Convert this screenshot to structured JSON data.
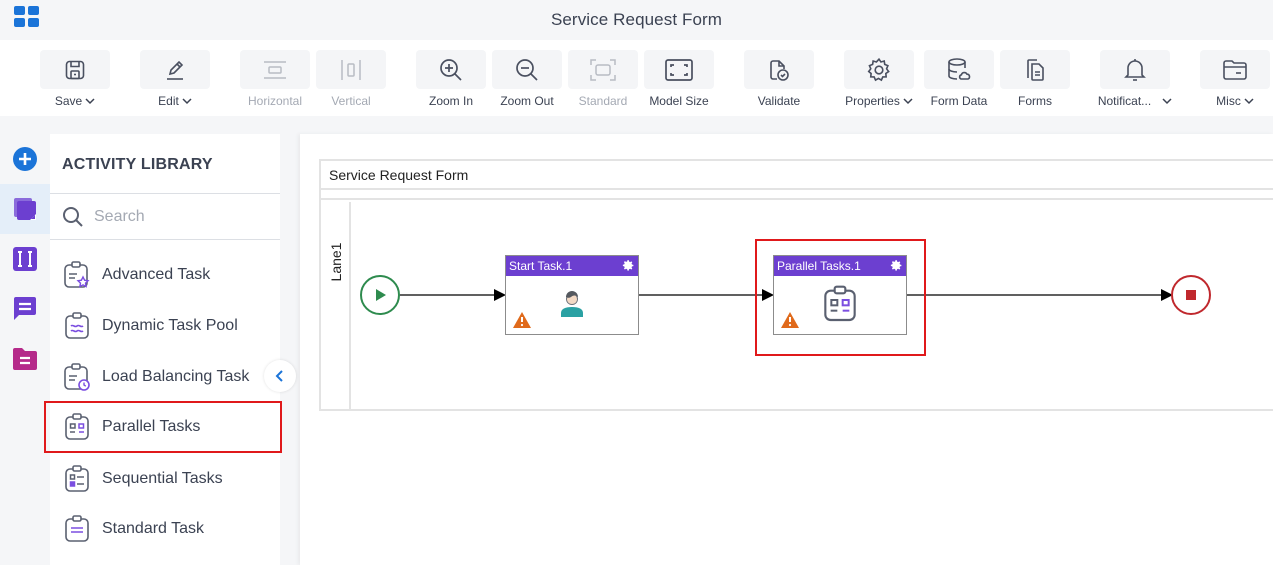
{
  "app": {
    "title": "Service Request Form",
    "launcher_icon": "app-grid-icon"
  },
  "toolbar": {
    "buttons": [
      {
        "id": "save",
        "label": "Save",
        "icon": "save-icon",
        "dropdown": true,
        "disabled": false
      },
      {
        "id": "edit",
        "label": "Edit",
        "icon": "pencil-icon",
        "dropdown": true,
        "disabled": false
      },
      {
        "id": "horizontal",
        "label": "Horizontal",
        "icon": "horizontal-layout-icon",
        "dropdown": false,
        "disabled": true
      },
      {
        "id": "vertical",
        "label": "Vertical",
        "icon": "vertical-layout-icon",
        "dropdown": false,
        "disabled": true
      },
      {
        "id": "zoom-in",
        "label": "Zoom In",
        "icon": "zoom-in-icon",
        "dropdown": false,
        "disabled": false
      },
      {
        "id": "zoom-out",
        "label": "Zoom Out",
        "icon": "zoom-out-icon",
        "dropdown": false,
        "disabled": false
      },
      {
        "id": "standard",
        "label": "Standard",
        "icon": "standard-size-icon",
        "dropdown": false,
        "disabled": true
      },
      {
        "id": "model-size",
        "label": "Model Size",
        "icon": "fit-screen-icon",
        "dropdown": false,
        "disabled": false
      },
      {
        "id": "validate",
        "label": "Validate",
        "icon": "validate-icon",
        "dropdown": false,
        "disabled": false
      },
      {
        "id": "properties",
        "label": "Properties",
        "icon": "gear-icon",
        "dropdown": true,
        "disabled": false
      },
      {
        "id": "form-data",
        "label": "Form Data",
        "icon": "database-icon",
        "dropdown": false,
        "disabled": false
      },
      {
        "id": "forms",
        "label": "Forms",
        "icon": "forms-icon",
        "dropdown": false,
        "disabled": false
      },
      {
        "id": "notifications",
        "label": "Notificat...",
        "icon": "bell-icon",
        "dropdown": true,
        "disabled": false
      },
      {
        "id": "misc",
        "label": "Misc",
        "icon": "folder-icon",
        "dropdown": true,
        "disabled": false
      }
    ]
  },
  "rail": {
    "items": [
      {
        "id": "add",
        "icon": "add-circle-icon",
        "active": false
      },
      {
        "id": "activity-library",
        "icon": "activity-library-icon",
        "active": true
      },
      {
        "id": "variables",
        "icon": "variables-icon",
        "active": false
      },
      {
        "id": "messages",
        "icon": "message-icon",
        "active": false
      },
      {
        "id": "documents",
        "icon": "document-folder-icon",
        "active": false
      }
    ]
  },
  "library": {
    "title": "ACTIVITY LIBRARY",
    "search": {
      "placeholder": "Search",
      "value": ""
    },
    "items": [
      {
        "label": "Advanced Task",
        "icon": "advanced-task-icon",
        "highlighted": false
      },
      {
        "label": "Dynamic Task Pool",
        "icon": "dynamic-task-pool-icon",
        "highlighted": false
      },
      {
        "label": "Load Balancing Task",
        "icon": "load-balancing-task-icon",
        "highlighted": false
      },
      {
        "label": "Parallel Tasks",
        "icon": "parallel-tasks-icon",
        "highlighted": true
      },
      {
        "label": "Sequential Tasks",
        "icon": "sequential-tasks-icon",
        "highlighted": false
      },
      {
        "label": "Standard Task",
        "icon": "standard-task-icon",
        "highlighted": false
      }
    ]
  },
  "canvas": {
    "pool_title": "Service Request Form",
    "lane_label": "Lane1",
    "nodes": [
      {
        "id": "start",
        "type": "start-event"
      },
      {
        "id": "start-task",
        "type": "task",
        "label": "Start Task.1",
        "icon": "user-icon",
        "warning": true,
        "selected": false
      },
      {
        "id": "parallel-tasks",
        "type": "task",
        "label": "Parallel Tasks.1",
        "icon": "parallel-tasks-icon",
        "warning": true,
        "selected": true
      },
      {
        "id": "end",
        "type": "end-event"
      }
    ]
  },
  "colors": {
    "accent_blue": "#1b74d8",
    "task_header": "#6c3fd0",
    "start_event": "#2e8b4e",
    "end_event": "#c0282d",
    "warning": "#e06a1b",
    "highlight_red": "#e0191b",
    "user_icon_body": "#2aa1a3"
  }
}
